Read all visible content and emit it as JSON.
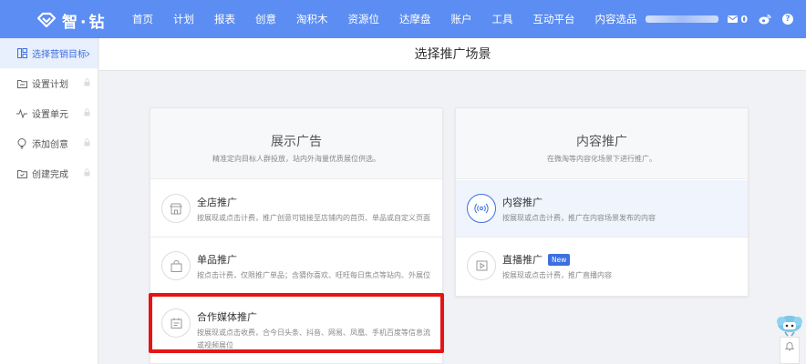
{
  "logo": {
    "text": "智·钻"
  },
  "nav": {
    "items": [
      "首页",
      "计划",
      "报表",
      "创意",
      "淘积木",
      "资源位",
      "达摩盘",
      "账户",
      "工具",
      "互动平台",
      "内容选品"
    ],
    "message_count": "0"
  },
  "sidebar": {
    "items": [
      {
        "label": "选择营销目标",
        "active": true
      },
      {
        "label": "设置计划",
        "active": false
      },
      {
        "label": "设置单元",
        "active": false
      },
      {
        "label": "添加创意",
        "active": false
      },
      {
        "label": "创建完成",
        "active": false
      }
    ]
  },
  "page": {
    "title": "选择推广场景"
  },
  "display_ads": {
    "title": "展示广告",
    "subtitle": "精准定向目标人群投放，站内外海量优质展位供选。",
    "options": [
      {
        "title": "全店推广",
        "desc": "按展现或点击计费，推广创意可链接至店铺内的首页、单品或自定义页面"
      },
      {
        "title": "单品推广",
        "desc": "按点击计费，仅限推广单品；含猜你喜欢、旺旺每日焦点等站内、外展位"
      },
      {
        "title": "合作媒体推广",
        "desc": "按展现或点击收费，合今日头条、抖音、网易、凤凰、手机百度等信息流或视频展位"
      }
    ]
  },
  "content_ads": {
    "title": "内容推广",
    "subtitle": "在微淘等内容化场景下进行推广。",
    "options": [
      {
        "title": "内容推广",
        "desc": "按展现或点击计费，推广在内容场景发布的内容",
        "badge": ""
      },
      {
        "title": "直播推广",
        "desc": "按展现或点击计费，推广直播内容",
        "badge": "New"
      }
    ]
  },
  "colors": {
    "nav_bg": "#5c8df2",
    "accent": "#3d6fe0",
    "highlight": "#e61414"
  },
  "icons": {
    "logo": "diamond-logo-icon",
    "message": "mail-icon",
    "weibo": "weibo-icon",
    "help": "question-icon",
    "sidebar": [
      "target-icon",
      "folder-icon",
      "pulse-icon",
      "bulb-icon",
      "folder-check-icon"
    ],
    "lock": "lock-icon",
    "options": [
      "store-icon",
      "bag-icon",
      "media-list-icon",
      "broadcast-icon",
      "play-icon"
    ]
  }
}
